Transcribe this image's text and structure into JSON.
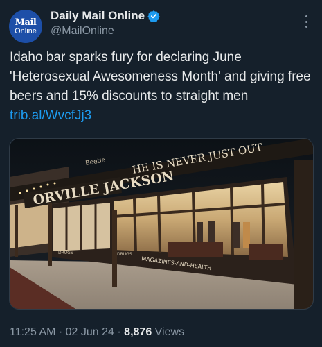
{
  "account": {
    "avatar_line1": "Mail",
    "avatar_line2": "Online",
    "name": "Daily Mail Online",
    "handle": "@MailOnline"
  },
  "tweet": {
    "text": "Idaho bar sparks fury for declaring June 'Heterosexual Awesomeness Month' and giving free beers and 15% discounts to straight men ",
    "link": "trib.al/WvcfJj3"
  },
  "photo": {
    "sign_main": "ORVILLE JACKSON",
    "sign_top": "HE IS NEVER JUST OUT",
    "sign_small": "Beetle",
    "sign_bottom": "MAGAZINES-AND-HEALTH",
    "small_left": "DRUGS",
    "small_right": "DRUGS"
  },
  "meta": {
    "time": "11:25 AM",
    "date": "02 Jun 24",
    "separator": "·",
    "views_count": "8,876",
    "views_label": "Views"
  },
  "colors": {
    "background": "#15202b",
    "link": "#1d9bf0",
    "secondary": "#8b98a5",
    "verified": "#1d9bf0"
  }
}
